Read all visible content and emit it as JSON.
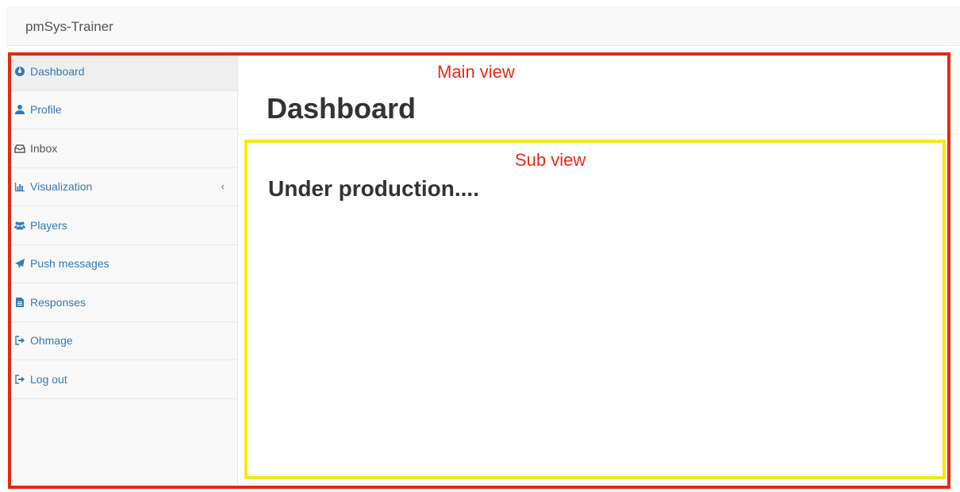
{
  "navbar": {
    "brand": "pmSys-Trainer"
  },
  "sidebar": {
    "items": [
      {
        "label": "Dashboard",
        "icon": "dashboard-icon"
      },
      {
        "label": "Profile",
        "icon": "user-icon"
      },
      {
        "label": "Inbox",
        "icon": "inbox-icon"
      },
      {
        "label": "Visualization",
        "icon": "bar-chart-icon",
        "chevron": "‹"
      },
      {
        "label": "Players",
        "icon": "users-icon"
      },
      {
        "label": "Push messages",
        "icon": "paper-plane-icon"
      },
      {
        "label": "Responses",
        "icon": "file-icon"
      },
      {
        "label": "Ohmage",
        "icon": "sign-out-icon"
      },
      {
        "label": "Log out",
        "icon": "sign-out-icon"
      }
    ]
  },
  "main": {
    "title": "Dashboard",
    "sub_heading": "Under production...."
  },
  "annotations": {
    "main_view": "Main view",
    "sub_view": "Sub view",
    "main_color": "#e22a12",
    "sub_color": "#f3ea10"
  },
  "colors": {
    "link": "#337ab7",
    "active_bg": "#eeeeee"
  }
}
